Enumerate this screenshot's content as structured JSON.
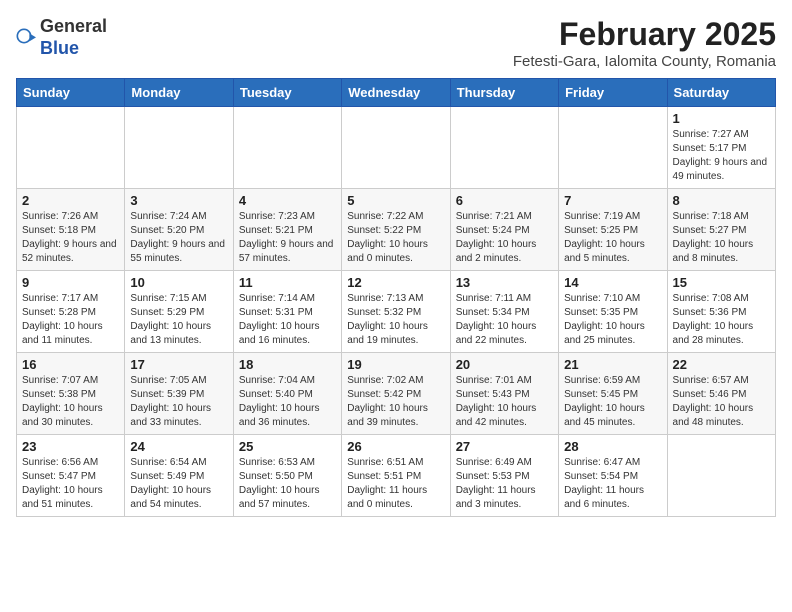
{
  "header": {
    "logo_general": "General",
    "logo_blue": "Blue",
    "month_title": "February 2025",
    "location": "Fetesti-Gara, Ialomita County, Romania"
  },
  "weekdays": [
    "Sunday",
    "Monday",
    "Tuesday",
    "Wednesday",
    "Thursday",
    "Friday",
    "Saturday"
  ],
  "weeks": [
    [
      {
        "day": "",
        "info": ""
      },
      {
        "day": "",
        "info": ""
      },
      {
        "day": "",
        "info": ""
      },
      {
        "day": "",
        "info": ""
      },
      {
        "day": "",
        "info": ""
      },
      {
        "day": "",
        "info": ""
      },
      {
        "day": "1",
        "info": "Sunrise: 7:27 AM\nSunset: 5:17 PM\nDaylight: 9 hours and 49 minutes."
      }
    ],
    [
      {
        "day": "2",
        "info": "Sunrise: 7:26 AM\nSunset: 5:18 PM\nDaylight: 9 hours and 52 minutes."
      },
      {
        "day": "3",
        "info": "Sunrise: 7:24 AM\nSunset: 5:20 PM\nDaylight: 9 hours and 55 minutes."
      },
      {
        "day": "4",
        "info": "Sunrise: 7:23 AM\nSunset: 5:21 PM\nDaylight: 9 hours and 57 minutes."
      },
      {
        "day": "5",
        "info": "Sunrise: 7:22 AM\nSunset: 5:22 PM\nDaylight: 10 hours and 0 minutes."
      },
      {
        "day": "6",
        "info": "Sunrise: 7:21 AM\nSunset: 5:24 PM\nDaylight: 10 hours and 2 minutes."
      },
      {
        "day": "7",
        "info": "Sunrise: 7:19 AM\nSunset: 5:25 PM\nDaylight: 10 hours and 5 minutes."
      },
      {
        "day": "8",
        "info": "Sunrise: 7:18 AM\nSunset: 5:27 PM\nDaylight: 10 hours and 8 minutes."
      }
    ],
    [
      {
        "day": "9",
        "info": "Sunrise: 7:17 AM\nSunset: 5:28 PM\nDaylight: 10 hours and 11 minutes."
      },
      {
        "day": "10",
        "info": "Sunrise: 7:15 AM\nSunset: 5:29 PM\nDaylight: 10 hours and 13 minutes."
      },
      {
        "day": "11",
        "info": "Sunrise: 7:14 AM\nSunset: 5:31 PM\nDaylight: 10 hours and 16 minutes."
      },
      {
        "day": "12",
        "info": "Sunrise: 7:13 AM\nSunset: 5:32 PM\nDaylight: 10 hours and 19 minutes."
      },
      {
        "day": "13",
        "info": "Sunrise: 7:11 AM\nSunset: 5:34 PM\nDaylight: 10 hours and 22 minutes."
      },
      {
        "day": "14",
        "info": "Sunrise: 7:10 AM\nSunset: 5:35 PM\nDaylight: 10 hours and 25 minutes."
      },
      {
        "day": "15",
        "info": "Sunrise: 7:08 AM\nSunset: 5:36 PM\nDaylight: 10 hours and 28 minutes."
      }
    ],
    [
      {
        "day": "16",
        "info": "Sunrise: 7:07 AM\nSunset: 5:38 PM\nDaylight: 10 hours and 30 minutes."
      },
      {
        "day": "17",
        "info": "Sunrise: 7:05 AM\nSunset: 5:39 PM\nDaylight: 10 hours and 33 minutes."
      },
      {
        "day": "18",
        "info": "Sunrise: 7:04 AM\nSunset: 5:40 PM\nDaylight: 10 hours and 36 minutes."
      },
      {
        "day": "19",
        "info": "Sunrise: 7:02 AM\nSunset: 5:42 PM\nDaylight: 10 hours and 39 minutes."
      },
      {
        "day": "20",
        "info": "Sunrise: 7:01 AM\nSunset: 5:43 PM\nDaylight: 10 hours and 42 minutes."
      },
      {
        "day": "21",
        "info": "Sunrise: 6:59 AM\nSunset: 5:45 PM\nDaylight: 10 hours and 45 minutes."
      },
      {
        "day": "22",
        "info": "Sunrise: 6:57 AM\nSunset: 5:46 PM\nDaylight: 10 hours and 48 minutes."
      }
    ],
    [
      {
        "day": "23",
        "info": "Sunrise: 6:56 AM\nSunset: 5:47 PM\nDaylight: 10 hours and 51 minutes."
      },
      {
        "day": "24",
        "info": "Sunrise: 6:54 AM\nSunset: 5:49 PM\nDaylight: 10 hours and 54 minutes."
      },
      {
        "day": "25",
        "info": "Sunrise: 6:53 AM\nSunset: 5:50 PM\nDaylight: 10 hours and 57 minutes."
      },
      {
        "day": "26",
        "info": "Sunrise: 6:51 AM\nSunset: 5:51 PM\nDaylight: 11 hours and 0 minutes."
      },
      {
        "day": "27",
        "info": "Sunrise: 6:49 AM\nSunset: 5:53 PM\nDaylight: 11 hours and 3 minutes."
      },
      {
        "day": "28",
        "info": "Sunrise: 6:47 AM\nSunset: 5:54 PM\nDaylight: 11 hours and 6 minutes."
      },
      {
        "day": "",
        "info": ""
      }
    ]
  ]
}
